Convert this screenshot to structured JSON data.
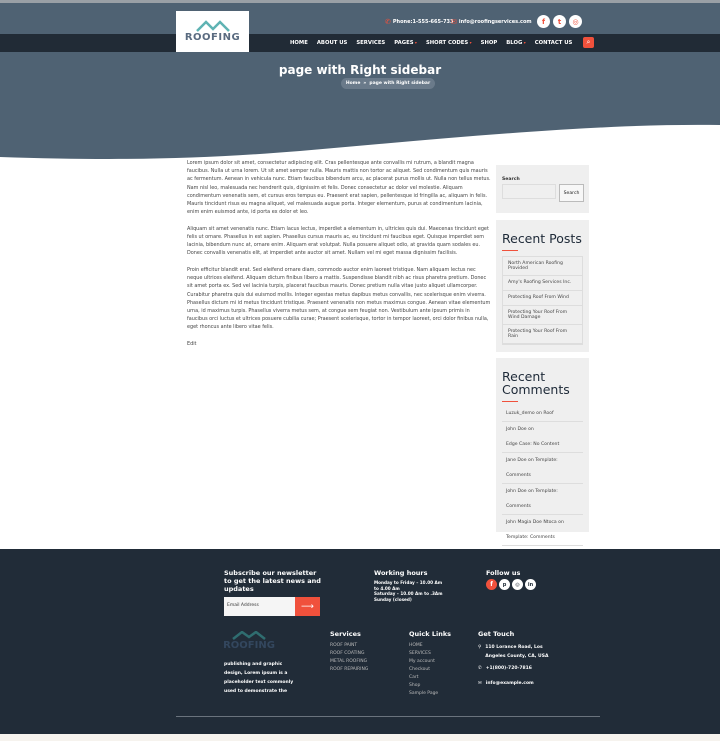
{
  "header": {
    "logo_text": "ROOFING",
    "phone": "Phone:1-555-665-733",
    "email": "info@roofingservices.com",
    "social": [
      {
        "icon": "facebook-icon",
        "glyph": "f"
      },
      {
        "icon": "twitter-icon",
        "glyph": "t"
      },
      {
        "icon": "instagram-icon",
        "glyph": "◎"
      }
    ],
    "menu": [
      {
        "label": "HOME"
      },
      {
        "label": "ABOUT US"
      },
      {
        "label": "SERVICES"
      },
      {
        "label": "PAGES",
        "dropdown": true
      },
      {
        "label": "SHORT CODES",
        "dropdown": true
      },
      {
        "label": "SHOP"
      },
      {
        "label": "BLOG",
        "dropdown": true
      },
      {
        "label": "CONTACT US"
      }
    ],
    "accent": "#f0513c",
    "hero_color": "#4f6273",
    "nav_color": "#212b36"
  },
  "page": {
    "title": "page with Right sidebar",
    "breadcrumb": {
      "home": "Home",
      "sep": "»",
      "current": "page with Right sidebar"
    }
  },
  "content": {
    "paragraphs": [
      "Lorem ipsum dolor sit amet, consectetur adipiscing elit. Cras pellentesque ante convallis mi rutrum, a blandit magna faucibus. Nulla ut urna lorem. Ut sit amet semper nulla. Mauris mattis non tortor ac aliquet. Sed condimentum quis mauris ac fermentum. Aenean in vehicula nunc. Etiam faucibus bibendum arcu, ac placerat purus mollis ut. Nulla non tellus metus. Nam nisl leo, malesuada nec hendrerit quis, dignissim et felis. Donec consectetur ac dolor vel molestie. Aliquam condimentum venenatis sem, et cursus eros tempus eu. Praesent erat sapien, pellentesque id fringilla ac, aliquam in felis. Mauris tincidunt risus eu magna aliquet, vel malesuada augue porta. Integer elementum, purus at condimentum lacinia, enim enim euismod ante, id porta ex dolor et leo.",
      "Aliquam sit amet venenatis nunc. Etiam lacus lectus, imperdiet a elementum in, ultricies quis dui. Maecenas tincidunt eget felis ut ornare. Phasellus in est sapien. Phasellus cursus mauris ac, eu tincidunt mi faucibus eget. Quisque imperdiet sem lacinia, bibendum nunc at, ornare enim. Aliquam erat volutpat. Nulla posuere aliquet odio, at gravida quam sodales eu. Donec convallis venenatis elit, at imperdiet ante auctor sit amet. Nullam vel mi eget massa dignissim facilisis.",
      "Proin efficitur blandit erat. Sed eleifend ornare diam, commodo auctor enim laoreet tristique. Nam aliquam lectus nec neque ultrices eleifend. Aliquam dictum finibus libero a mattis. Suspendisse blandit nibh ac risus pharetra pretium. Donec sit amet porta ex. Sed vel lacinia turpis, placerat faucibus mauris. Donec pretium nulla vitae justo aliquet ullamcorper. Curabitur pharetra quis dui euismod mollis. Integer egestas metus dapibus metus convallis, nec scelerisque enim viverra. Phasellus dictum mi id metus tincidunt tristique. Praesent venenatis non metus maximus congue. Aenean vitae elementum urna, id maximus turpis. Phasellus viverra metus sem, at congue sem feugiat non. Vestibulum ante ipsum primis in faucibus orci luctus et ultrices posuere cubilia curae; Praesent scelerisque, tortor in tempor laoreet, orci dolor finibus nulla, eget rhoncus ante libero vitae felis."
    ],
    "edit": "Edit"
  },
  "sidebar": {
    "search": {
      "label": "Search",
      "button": "Search",
      "value": ""
    },
    "recent_posts": {
      "title": "Recent Posts",
      "items": [
        "North American Roofing Provided",
        "Amy's Roofing Services Inc.",
        "Protecting Roof From Wind",
        "Protecting Your Roof From Wind Damage",
        "Protecting Your Roof From Rain"
      ]
    },
    "recent_comments": {
      "title": "Recent Comments",
      "items": [
        "Luzuk_demo on Roof",
        "John Doe on",
        "Edge Case: No Content",
        "Jane Doe on Template: Comments",
        "John Doe on Template: Comments",
        "John Magia Doe Ntoca on",
        "Template: Comments"
      ]
    }
  },
  "footer": {
    "newsletter": {
      "title": "Subscribe our newsletter to get the latest news and updates",
      "placeholder": "Email Address"
    },
    "hours": {
      "title": "Working hours",
      "lines": [
        "Monday to Friday – 10.00 Am to 4.00 Am",
        "Saturday – 10.00 Am to .3Am",
        "Sunday (closed)"
      ]
    },
    "follow": {
      "title": "Follow us",
      "icons": [
        {
          "icon": "facebook-icon",
          "glyph": "f"
        },
        {
          "icon": "pinterest-icon",
          "glyph": "p"
        },
        {
          "icon": "instagram-icon",
          "glyph": "◎"
        },
        {
          "icon": "linkedin-icon",
          "glyph": "in"
        }
      ]
    },
    "about": {
      "logo_text": "ROOFING",
      "text": "publishing and graphic design, Lorem ipsum is a placeholder text commonly used to demonstrate the"
    },
    "services": {
      "title": "Services",
      "items": [
        "ROOF PAINT",
        "ROOF COATING",
        "METAL ROOFING",
        "ROOF REPAIRING"
      ]
    },
    "quick_links": {
      "title": "Quick Links",
      "items": [
        "HOME",
        "SERVICES",
        "My account",
        "Checkout",
        "Cart",
        "Shop",
        "Sample Page"
      ]
    },
    "contact": {
      "title": "Get Touch",
      "address": "110 Lorance Road, Los Angeles County, CA, USA",
      "phone": "+1(800)-720-7816",
      "email": "info@example.com"
    }
  }
}
